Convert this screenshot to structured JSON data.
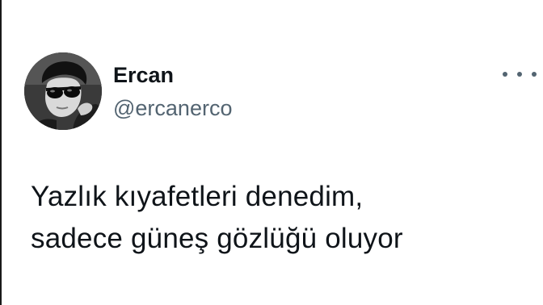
{
  "tweet": {
    "author": {
      "display_name": "Ercan",
      "handle": "@ercanerco",
      "avatar_icon": "profile-photo"
    },
    "more_icon": "more-horizontal-icon",
    "text_lines": [
      "Yazlık kıyafetleri denedim,",
      "sadece güneş gözlüğü oluyor"
    ]
  },
  "colors": {
    "text_primary": "#0f1419",
    "text_secondary": "#536471",
    "background": "#ffffff"
  }
}
